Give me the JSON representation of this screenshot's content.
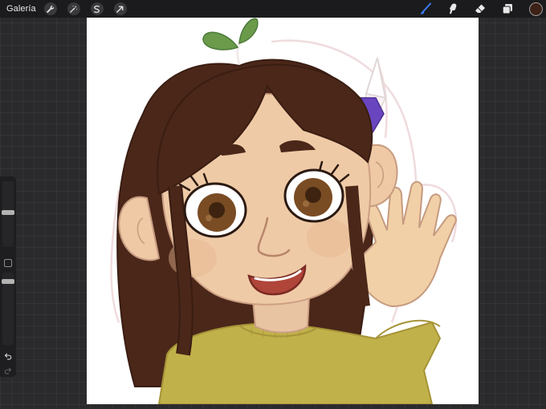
{
  "topbar": {
    "gallery_label": "Galería",
    "left_tools": [
      "wrench-icon",
      "magic-wand-icon",
      "selection-icon",
      "transform-arrow-icon"
    ],
    "right_tools": [
      "brush-icon",
      "smudge-icon",
      "eraser-icon",
      "layers-icon"
    ],
    "active_tool": "brush-icon",
    "active_tool_color": "#3b7bf6",
    "current_color": "#3d2016"
  },
  "sidebar": {
    "brush_size": 0.45,
    "opacity": 0.15
  }
}
